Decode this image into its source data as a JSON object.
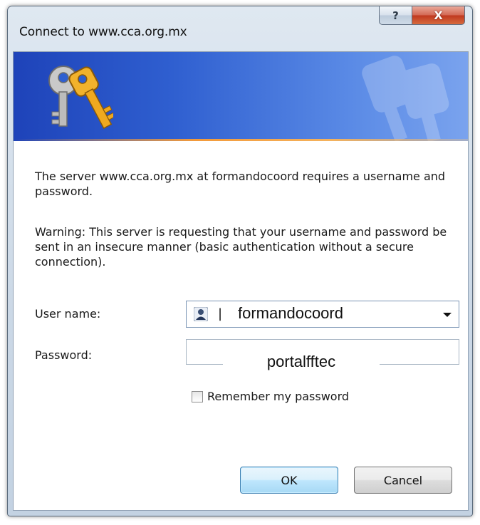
{
  "window": {
    "title": "Connect to www.cca.org.mx",
    "help_glyph": "?",
    "close_glyph": "X"
  },
  "banner": {
    "icon": "keys-icon",
    "accent": "#2f5fd0"
  },
  "message": {
    "line1": "The server www.cca.org.mx at formandocoord requires a username and password.",
    "line2": "Warning: This server is requesting that your username and password be sent in an insecure manner (basic authentication without a secure connection)."
  },
  "form": {
    "username_label": "User name:",
    "username_value": "formandocoord",
    "password_label": "Password:",
    "password_value": "portalfftec",
    "remember_label": "Remember my password",
    "remember_checked": false
  },
  "buttons": {
    "ok": "OK",
    "cancel": "Cancel"
  }
}
